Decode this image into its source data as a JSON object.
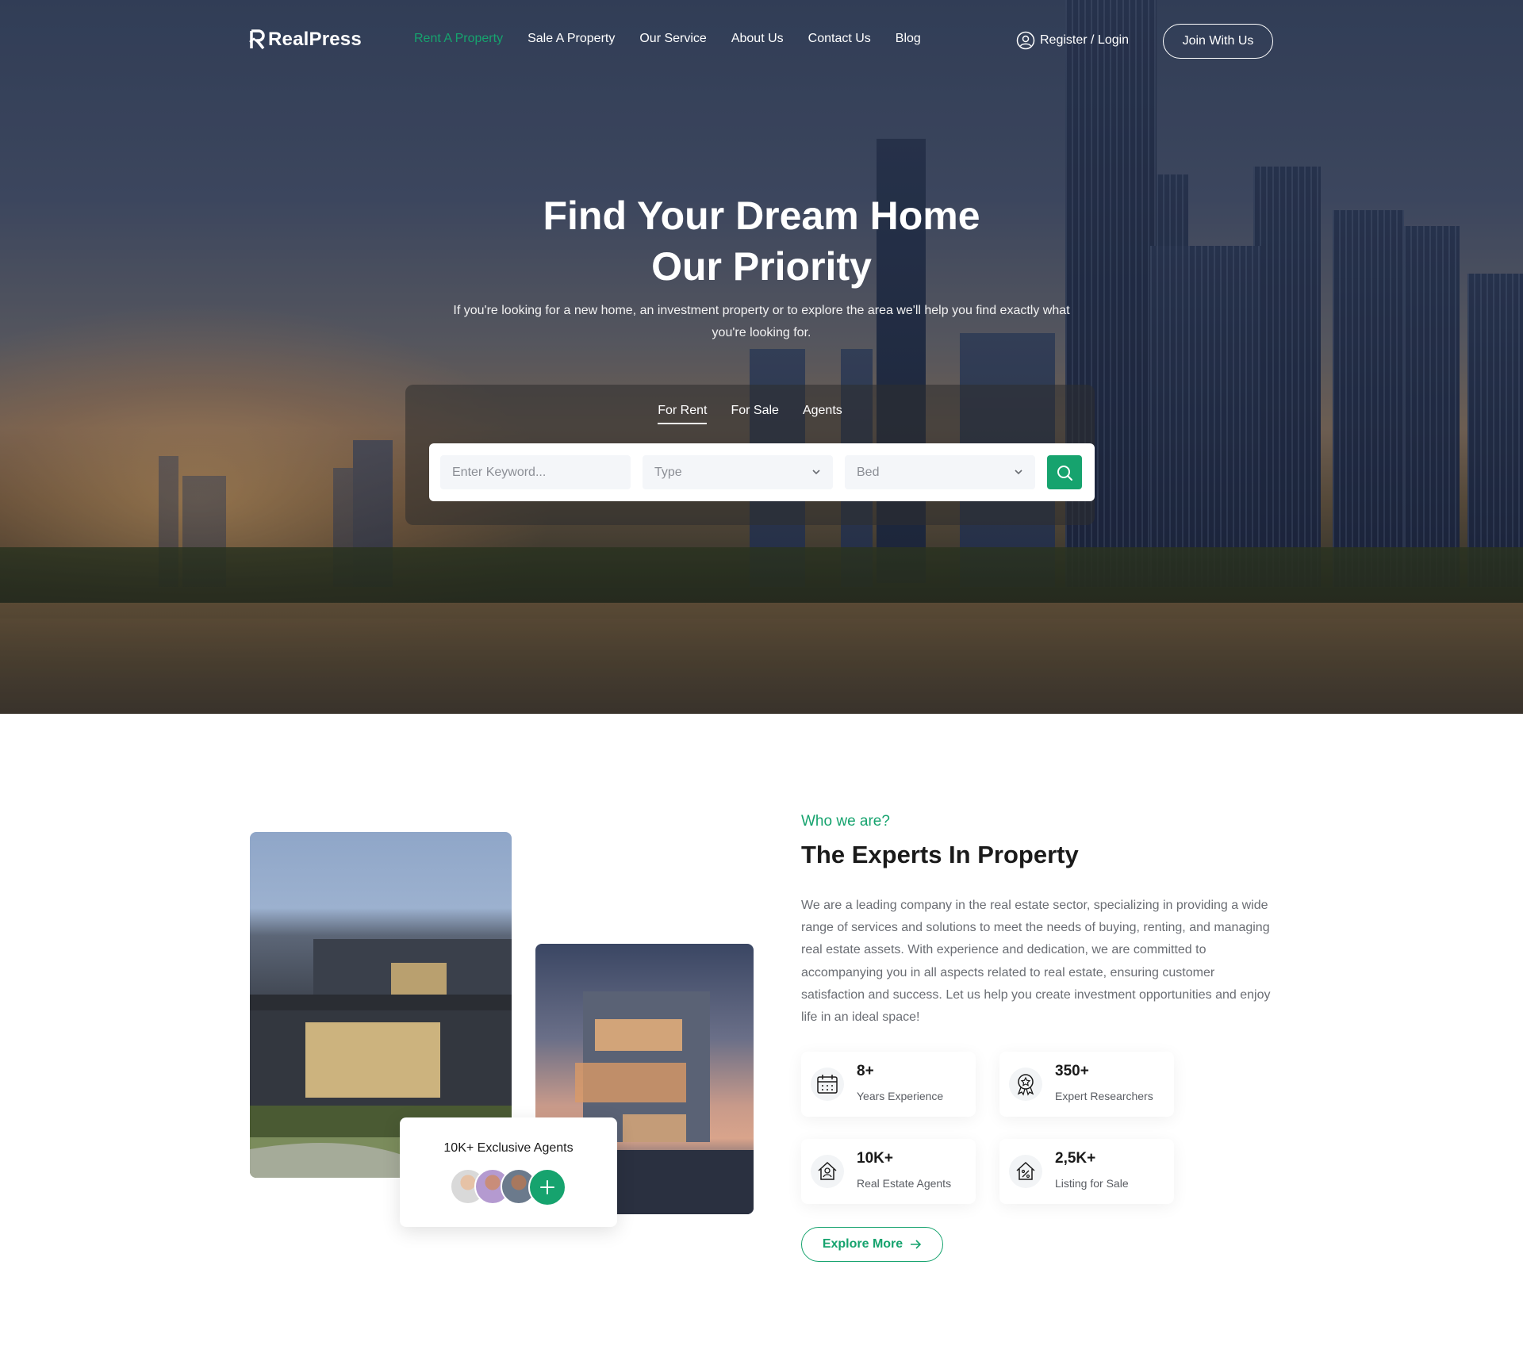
{
  "brand": {
    "name": "RealPress"
  },
  "nav": {
    "items": [
      {
        "label": "Rent A Property",
        "active": true
      },
      {
        "label": "Sale A Property",
        "active": false
      },
      {
        "label": "Our Service",
        "active": false
      },
      {
        "label": "About Us",
        "active": false
      },
      {
        "label": "Contact Us",
        "active": false
      },
      {
        "label": "Blog",
        "active": false
      }
    ],
    "register_label": "Register / Login",
    "join_label": "Join With Us"
  },
  "hero": {
    "title_line1": "Find Your Dream Home",
    "title_line2": "Our Priority",
    "subtitle": "If you're looking for a new home, an investment property or to explore the area we'll help you find exactly what you're looking for."
  },
  "search": {
    "tabs": [
      {
        "label": "For Rent",
        "active": true
      },
      {
        "label": "For Sale",
        "active": false
      },
      {
        "label": "Agents",
        "active": false
      }
    ],
    "keyword_placeholder": "Enter Keyword...",
    "type_value": "Type",
    "bed_value": "Bed"
  },
  "about": {
    "eyebrow": "Who we are?",
    "title": "The Experts In Property",
    "body": "We are a leading company in the real estate sector, specializing in providing a wide range of services and solutions to meet the needs of buying, renting, and managing real estate assets. With experience and dedication, we are committed to accompanying you in all aspects related to real estate, ensuring customer satisfaction and success. Let us help you create investment opportunities and enjoy life in an ideal space!",
    "agents_card_title": "10K+ Exclusive Agents",
    "stats": [
      {
        "value": "8+",
        "label": "Years Experience",
        "icon": "calendar-icon"
      },
      {
        "value": "350+",
        "label": "Expert Researchers",
        "icon": "award-icon"
      },
      {
        "value": "10K+",
        "label": "Real Estate Agents",
        "icon": "house-user-icon"
      },
      {
        "value": "2,5K+",
        "label": "Listing for Sale",
        "icon": "house-percent-icon"
      }
    ],
    "explore_label": "Explore More"
  },
  "colors": {
    "accent": "#16a36e",
    "text_dark": "#1a1a1a",
    "text_muted": "#6a6d73"
  }
}
